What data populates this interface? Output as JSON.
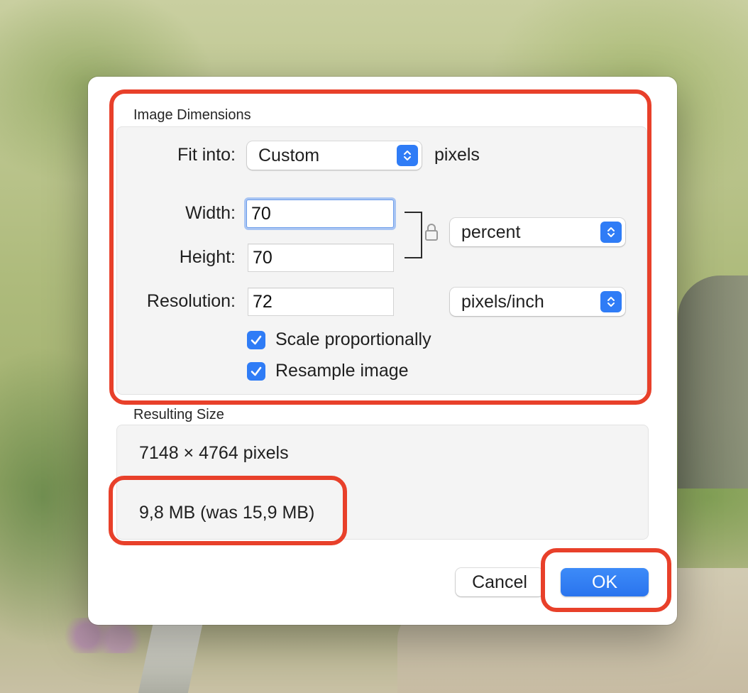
{
  "dialog": {
    "image_dimensions": {
      "section_label": "Image Dimensions",
      "fit_into": {
        "label": "Fit into:",
        "value": "Custom",
        "unit": "pixels"
      },
      "width": {
        "label": "Width:",
        "value": "70"
      },
      "height": {
        "label": "Height:",
        "value": "70"
      },
      "size_unit": "percent",
      "resolution": {
        "label": "Resolution:",
        "value": "72",
        "unit": "pixels/inch"
      },
      "scale_proportionally": {
        "label": "Scale proportionally",
        "checked": true
      },
      "resample_image": {
        "label": "Resample image",
        "checked": true
      }
    },
    "resulting_size": {
      "section_label": "Resulting Size",
      "dimensions": "7148 × 4764 pixels",
      "file_size": "9,8 MB (was 15,9 MB)"
    },
    "buttons": {
      "cancel": "Cancel",
      "ok": "OK"
    }
  },
  "colors": {
    "accent": "#2f7cf6",
    "highlight": "#e8402a"
  },
  "icons": {
    "stepper": "chevron-up-down-icon",
    "lock": "lock-icon",
    "check": "checkmark-icon"
  }
}
